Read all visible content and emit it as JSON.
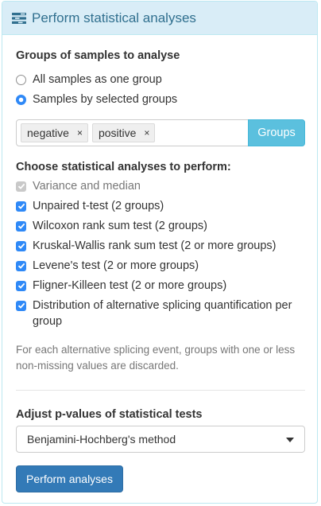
{
  "panel": {
    "title": "Perform statistical analyses",
    "icon": "tasks-icon"
  },
  "groups": {
    "title": "Groups of samples to analyse",
    "options": [
      {
        "label": "All samples as one group",
        "checked": false
      },
      {
        "label": "Samples by selected groups",
        "checked": true
      }
    ],
    "selected_tokens": [
      "negative",
      "positive"
    ],
    "remove_glyph": "×",
    "groups_button": "Groups"
  },
  "analyses": {
    "title": "Choose statistical analyses to perform:",
    "items": [
      {
        "label": "Variance and median",
        "checked": true,
        "disabled": true
      },
      {
        "label": "Unpaired t-test (2 groups)",
        "checked": true,
        "disabled": false
      },
      {
        "label": "Wilcoxon rank sum test (2 groups)",
        "checked": true,
        "disabled": false
      },
      {
        "label": "Kruskal-Wallis rank sum test (2 or more groups)",
        "checked": true,
        "disabled": false
      },
      {
        "label": "Levene's test (2 or more groups)",
        "checked": true,
        "disabled": false
      },
      {
        "label": "Fligner-Killeen test (2 or more groups)",
        "checked": true,
        "disabled": false
      },
      {
        "label": "Distribution of alternative splicing quantification per",
        "checked": true,
        "disabled": false
      },
      {
        "label": "group"
      }
    ],
    "note": "For each alternative splicing event, groups with one or less non-missing values are discarded."
  },
  "pvalue": {
    "title": "Adjust p-values of statistical tests",
    "selected": "Benjamini-Hochberg's method"
  },
  "submit_label": "Perform analyses",
  "colors": {
    "heading_bg": "#d9edf7",
    "heading_text": "#31708f",
    "info_button": "#5bc0de",
    "primary_button": "#337ab7",
    "checkbox": "#2f89f7"
  }
}
